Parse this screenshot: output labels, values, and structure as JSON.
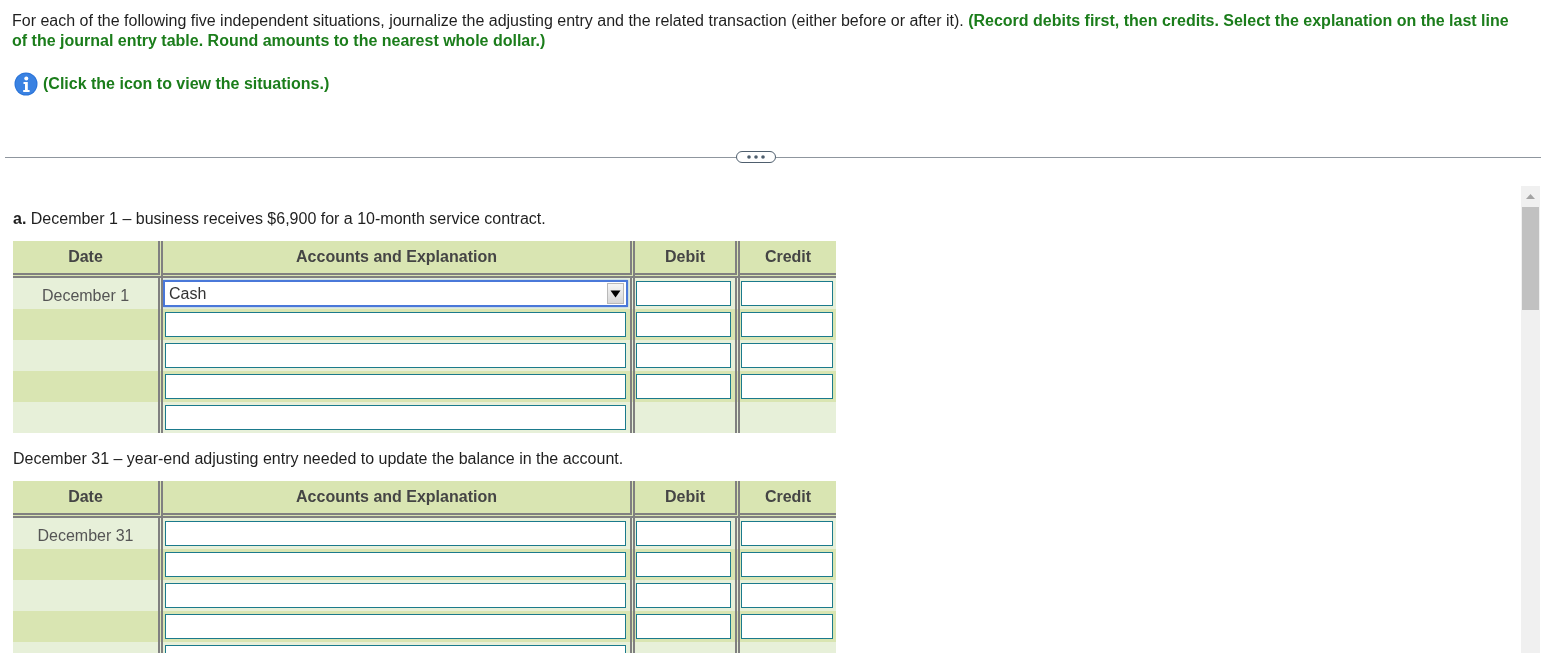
{
  "instructions": "For each of the following five independent situations, journalize the adjusting entry and the related transaction (either before or after it). **(Record debits first, then credits. Select the explanation on the last line of the journal entry table. Round amounts to the nearest whole dollar.)**",
  "info_link": {
    "text": "(Click the icon to view the situations.)"
  },
  "sections": [
    {
      "prompt": "**a.** December 1 – business receives $6,900 for a 10-month service contract.",
      "table": {
        "columns": [
          "Date",
          "Accounts and Explanation",
          "Debit",
          "Credit"
        ],
        "rows": [
          {
            "kind": "entry",
            "date": "December 1",
            "account": {
              "value": "Cash",
              "focused": true
            }
          },
          {
            "kind": "entry",
            "account": {
              "focused": false
            }
          },
          {
            "kind": "entry",
            "account": {
              "focused": false
            }
          },
          {
            "kind": "entry",
            "account": {
              "focused": false
            }
          },
          {
            "kind": "explanation",
            "account": {
              "focused": false
            }
          }
        ]
      }
    },
    {
      "prompt": "December 31 – year-end adjusting entry needed to update the balance in the account.",
      "table": {
        "columns": [
          "Date",
          "Accounts and Explanation",
          "Debit",
          "Credit"
        ],
        "rows": [
          {
            "kind": "entry",
            "date": "December 31",
            "account": {
              "focused": false
            }
          },
          {
            "kind": "entry",
            "account": {
              "focused": false
            }
          },
          {
            "kind": "entry",
            "account": {
              "focused": false
            }
          },
          {
            "kind": "entry",
            "account": {
              "focused": false
            }
          },
          {
            "kind": "explanation",
            "account": {
              "focused": false
            }
          }
        ]
      }
    }
  ]
}
